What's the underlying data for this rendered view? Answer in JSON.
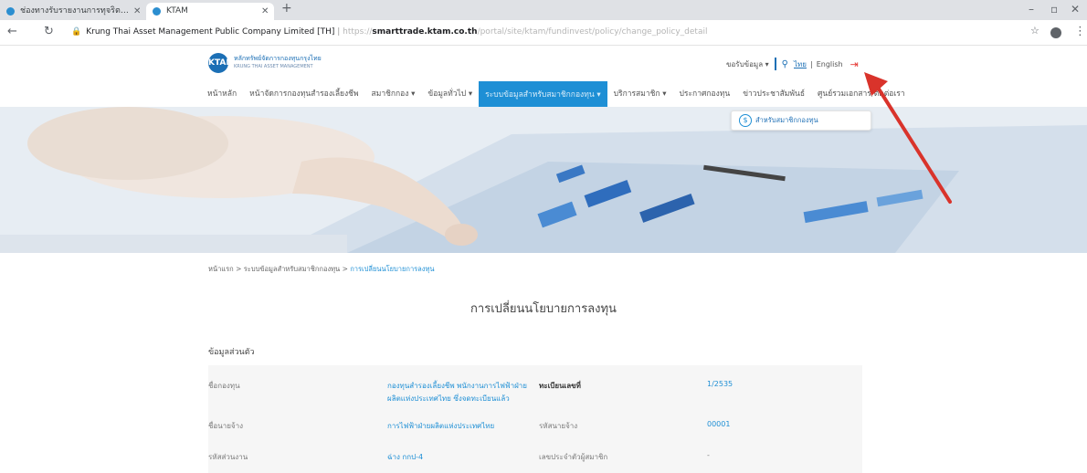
{
  "browser": {
    "tabs": [
      {
        "title": "ช่องทางรับรายงานการทุจริต…"
      },
      {
        "title": "KTAM"
      }
    ],
    "url": {
      "prefix": "Krung Thai Asset Management Public Company Limited [TH]",
      "scheme": "https://",
      "domain": "smarttrade.ktam.co.th",
      "path": "/portal/site/ktam/fundinvest/policy/change_policy_detail"
    }
  },
  "site": {
    "logo": {
      "mark": "KTAM",
      "line1": "หลักทรัพย์จัดการกองทุนกรุงไทย",
      "line2": "KRUNG THAI ASSET MANAGEMENT"
    },
    "topright": {
      "contact": "ขอรับข้อมูล",
      "lang_th": "ไทย",
      "lang_sep": "|",
      "lang_en": "English"
    },
    "nav": [
      "หน้าหลัก",
      "หน้าจัดการกองทุนสำรองเลี้ยงชีพ",
      "สมาชิกกอง",
      "ข้อมูลทั่วไป",
      "ระบบข้อมูลสำหรับสมาชิกกองทุน",
      "บริการสมาชิก",
      "ประกาศกองทุน",
      "ข่าวประชาสัมพันธ์",
      "ศูนย์รวมเอกสาร/ติดต่อเรา"
    ],
    "submenu_item": "สำหรับสมาชิกกองทุน"
  },
  "breadcrumb": {
    "home": "หน้าแรก",
    "sep": ">",
    "level2": "ระบบข้อมูลสำหรับสมาชิกกองทุน",
    "current": "การเปลี่ยนนโยบายการลงทุน"
  },
  "page": {
    "title": "การเปลี่ยนนโยบายการลงทุน",
    "section": "ข้อมูลส่วนตัว",
    "rows": [
      {
        "label": "ชื่อกองทุน",
        "value_line1": "กองทุนสำรองเลี้ยงชีพ พนักงานการไฟฟ้าฝ่าย",
        "value_line2": "ผลิตแห่งประเทศไทย ซึ่งจดทะเบียนแล้ว",
        "label2": "ทะเบียนเลขที่",
        "value2": "1/2535"
      },
      {
        "label": "ชื่อนายจ้าง",
        "value_line1": "การไฟฟ้าฝ่ายผลิตแห่งประเทศไทย",
        "label2": "รหัสนายจ้าง",
        "value2": "00001"
      },
      {
        "label": "รหัสส่วนงาน",
        "value_line1": "ฉ่าง กกป-4",
        "label2": "เลขประจำตัวผู้สมาชิก",
        "value2": "-"
      }
    ]
  }
}
